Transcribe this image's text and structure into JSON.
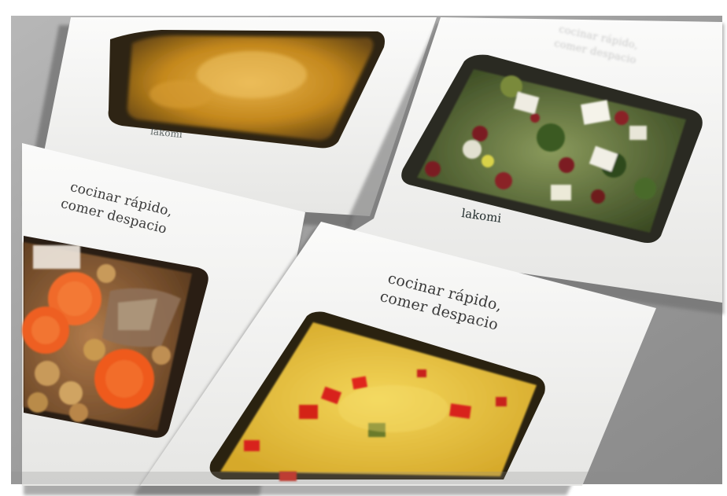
{
  "brand": {
    "name": "lakomi"
  },
  "packages": [
    {
      "food": "yellow-broth",
      "label": ""
    },
    {
      "food": "broccoli-salad",
      "label": ""
    },
    {
      "food": "chickpea-stew",
      "label": "cocinar rápido, comer despacio"
    },
    {
      "food": "yellow-rice",
      "label": "cocinar rápido, comer despacio"
    }
  ],
  "slogan": {
    "line1": "cocinar rápido,",
    "line2": "comer despacio"
  },
  "colors": {
    "box": "#f4f4f2",
    "backdrop": "#9c9c9c",
    "rice": "#e9c23a",
    "pepper": "#d8231b",
    "carrot": "#e8541d",
    "broth": "#c98d1f",
    "broccoli": "#3f6b2a"
  }
}
